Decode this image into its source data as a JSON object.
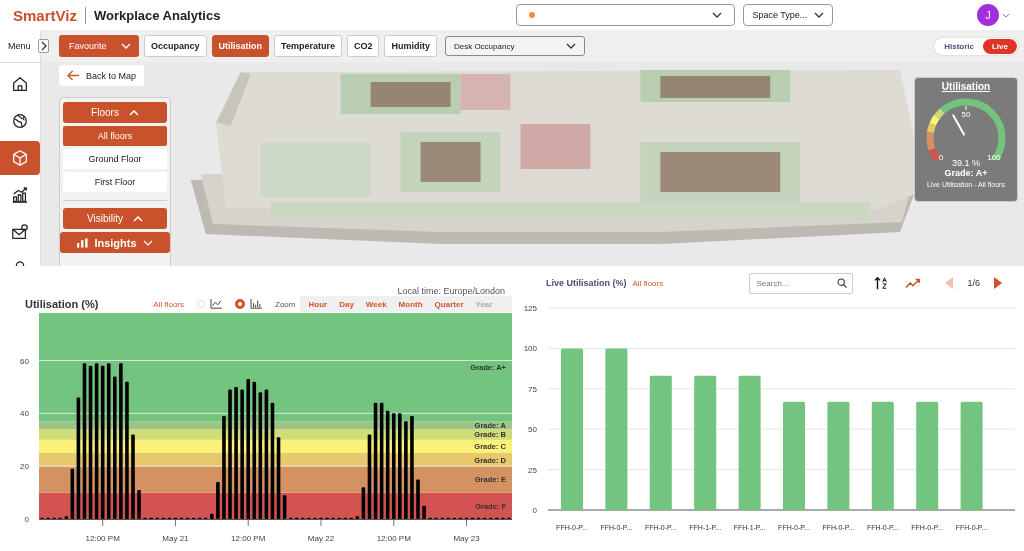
{
  "header": {
    "logo": "SmartViz",
    "app_title": "Workplace Analytics",
    "space_select": {
      "placeholder": "Space Type..."
    },
    "avatar": {
      "initial": "J"
    }
  },
  "toolbar": {
    "menu_label": "Menu",
    "favourite": "Favourite",
    "view_select": "Desk Occupancy",
    "tabs": [
      {
        "label": "Occupancy",
        "selected": false
      },
      {
        "label": "Utilisation",
        "selected": true
      },
      {
        "label": "Temperature",
        "selected": false
      },
      {
        "label": "CO2",
        "selected": false
      },
      {
        "label": "Humidity",
        "selected": false
      }
    ],
    "mode_toggle": [
      {
        "label": "Historic",
        "selected": false
      },
      {
        "label": "Live",
        "selected": true
      }
    ]
  },
  "sidebar": {
    "items": [
      {
        "selected": false
      },
      {
        "selected": false
      },
      {
        "selected": true
      },
      {
        "selected": false
      },
      {
        "selected": false
      },
      {
        "selected": false
      }
    ]
  },
  "viewer": {
    "back_button": "Back to Map",
    "floors": {
      "title": "Floors",
      "expanded": true,
      "items": [
        {
          "label": "All floors",
          "selected": true
        },
        {
          "label": "Ground Floor",
          "selected": false
        },
        {
          "label": "First Floor",
          "selected": false
        }
      ]
    },
    "visibility": {
      "title": "Visibility",
      "expanded": true
    },
    "insights": {
      "title": "Insights",
      "expanded": false
    },
    "gauge": {
      "title": "Utilisation",
      "level": 0.391,
      "min_label": "0",
      "mid_label": "50",
      "max_label": "100",
      "reading": "39.1 %",
      "grade": "Grade: A+",
      "caption": "Live Utilisation - All floors"
    }
  },
  "history_panel": {
    "local_time": "Local time: Europe/London",
    "title": "Utilisation (%)",
    "scope": "All floors",
    "chart_types": [
      {
        "kind": "line",
        "selected": false
      },
      {
        "kind": "bar",
        "selected": true
      }
    ],
    "zoom_label": "Zoom",
    "zoom_options": [
      {
        "label": "Hour",
        "disabled": false
      },
      {
        "label": "Day",
        "disabled": false
      },
      {
        "label": "Week",
        "disabled": false
      },
      {
        "label": "Month",
        "disabled": false
      },
      {
        "label": "Quarter",
        "disabled": false
      },
      {
        "label": "Year",
        "disabled": true
      }
    ],
    "chart_data": {
      "type": "bar",
      "ylim": [
        0,
        78
      ],
      "yticks": [
        0,
        20,
        40,
        60
      ],
      "grid": true,
      "categories": [
        null,
        null,
        null,
        null,
        null,
        null,
        null,
        null,
        null,
        null,
        "12:00 PM",
        null,
        null,
        null,
        null,
        null,
        null,
        null,
        null,
        null,
        null,
        null,
        "May 21",
        null,
        null,
        null,
        null,
        null,
        null,
        null,
        null,
        null,
        null,
        null,
        "12:00 PM",
        null,
        null,
        null,
        null,
        null,
        null,
        null,
        null,
        null,
        null,
        null,
        "May 22",
        null,
        null,
        null,
        null,
        null,
        null,
        null,
        null,
        null,
        null,
        null,
        "12:00 PM",
        null,
        null,
        null,
        null,
        null,
        null,
        null,
        null,
        null,
        null,
        null,
        "May 23",
        null,
        null,
        null,
        null,
        null,
        null,
        null
      ],
      "series": [
        {
          "color": "#000000",
          "values": [
            0,
            0,
            0,
            0,
            1,
            19,
            46,
            59,
            58,
            59,
            58,
            59,
            54,
            59,
            52,
            32,
            11,
            0,
            0,
            0,
            0,
            0,
            0,
            0,
            0,
            0,
            0,
            0,
            2,
            14,
            39,
            49,
            50,
            49,
            53,
            52,
            48,
            49,
            44,
            31,
            9,
            0,
            0,
            0,
            0,
            0,
            0,
            0,
            0,
            0,
            0,
            0,
            1,
            12,
            32,
            44,
            44,
            41,
            40,
            40,
            37,
            39,
            15,
            5,
            0,
            0,
            0,
            0,
            0,
            0,
            0,
            0,
            0,
            0,
            0,
            0,
            0,
            0
          ]
        }
      ],
      "bands": [
        {
          "label": "Grade: F",
          "axis": "y",
          "from": 0,
          "to": 10,
          "color": "#d35352"
        },
        {
          "label": "Grade: E",
          "axis": "y",
          "from": 10,
          "to": 20,
          "color": "#d49262"
        },
        {
          "label": "Grade: D",
          "axis": "y",
          "from": 20,
          "to": 25,
          "color": "#e8c86c"
        },
        {
          "label": "Grade: C",
          "axis": "y",
          "from": 25,
          "to": 30,
          "color": "#fcf277"
        },
        {
          "label": "Grade: B",
          "axis": "y",
          "from": 30,
          "to": 34,
          "color": "#d0dc76"
        },
        {
          "label": "Grade: A",
          "axis": "y",
          "from": 34,
          "to": 37,
          "color": "#9dc586"
        },
        {
          "label": "Grade: A+",
          "axis": "y",
          "from": 37,
          "to": 78,
          "color": "#72c47f"
        }
      ]
    }
  },
  "live_panel": {
    "title": "Live Utilisation (%)",
    "scope": "All floors",
    "search": {
      "placeholder": "Search..."
    },
    "page": "1/6",
    "prev": {
      "disabled": true
    },
    "next": {
      "disabled": false
    },
    "chart_data": {
      "type": "bar",
      "ylim": [
        0,
        125
      ],
      "yticks": [
        0,
        25,
        50,
        75,
        100,
        125
      ],
      "grid": true,
      "categories": [
        "FFH-0-P...",
        "FFH-0-P...",
        "FFH-0-P...",
        "FFH-1-P...",
        "FFH-1-P...",
        "FFH-0-P...",
        "FFH-0-P...",
        "FFH-0-P...",
        "FFH-0-P...",
        "FFH-0-P..."
      ],
      "series": [
        {
          "color": "#72c47f",
          "values": [
            100,
            100,
            83,
            83,
            83,
            67,
            67,
            67,
            67,
            67
          ]
        }
      ]
    }
  }
}
